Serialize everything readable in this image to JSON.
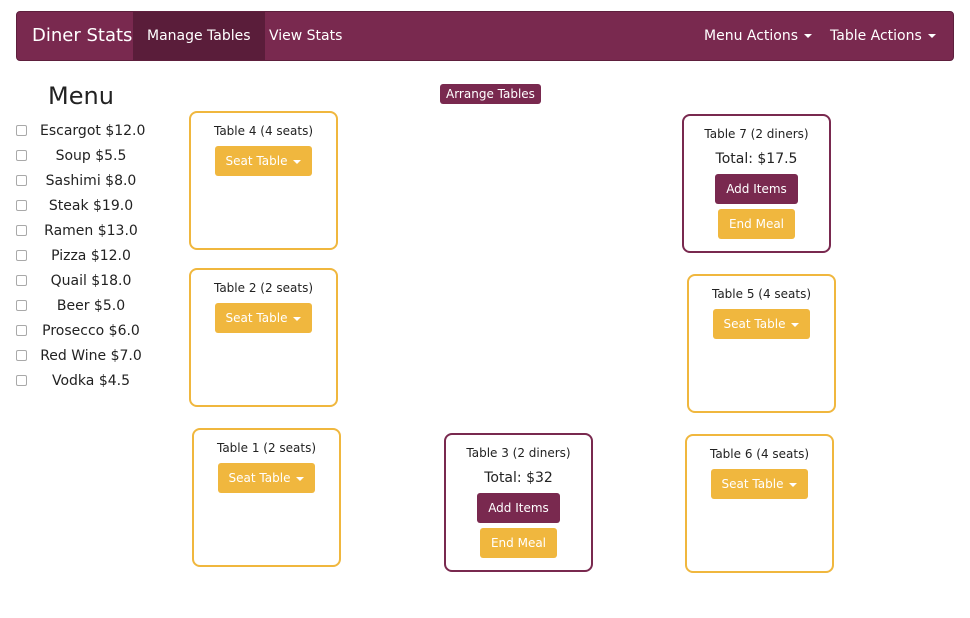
{
  "navbar": {
    "brand": "Diner Stats",
    "links": [
      "Manage Tables",
      "View Stats"
    ],
    "dropdowns": [
      "Menu Actions",
      "Table Actions"
    ]
  },
  "menu": {
    "title": "Menu",
    "items": [
      "Escargot $12.0",
      "Soup $5.5",
      "Sashimi $8.0",
      "Steak $19.0",
      "Ramen $13.0",
      "Pizza $12.0",
      "Quail $18.0",
      "Beer $5.0",
      "Prosecco $6.0",
      "Red Wine $7.0",
      "Vodka $4.5"
    ]
  },
  "arrange_label": "Arrange Tables",
  "buttons": {
    "seat": "Seat Table",
    "add": "Add Items",
    "end": "End Meal"
  },
  "tables": {
    "t4": {
      "title": "Table 4 (4 seats)"
    },
    "t2": {
      "title": "Table 2 (2 seats)"
    },
    "t1": {
      "title": "Table 1 (2 seats)"
    },
    "t3": {
      "title": "Table 3 (2 diners)",
      "total": "Total: $32"
    },
    "t7": {
      "title": "Table 7 (2 diners)",
      "total": "Total: $17.5"
    },
    "t5": {
      "title": "Table 5 (4 seats)"
    },
    "t6": {
      "title": "Table 6 (4 seats)"
    }
  },
  "colors": {
    "brand": "#79294f",
    "active_nav": "#5a1d3a",
    "warning": "#f0b73e"
  }
}
